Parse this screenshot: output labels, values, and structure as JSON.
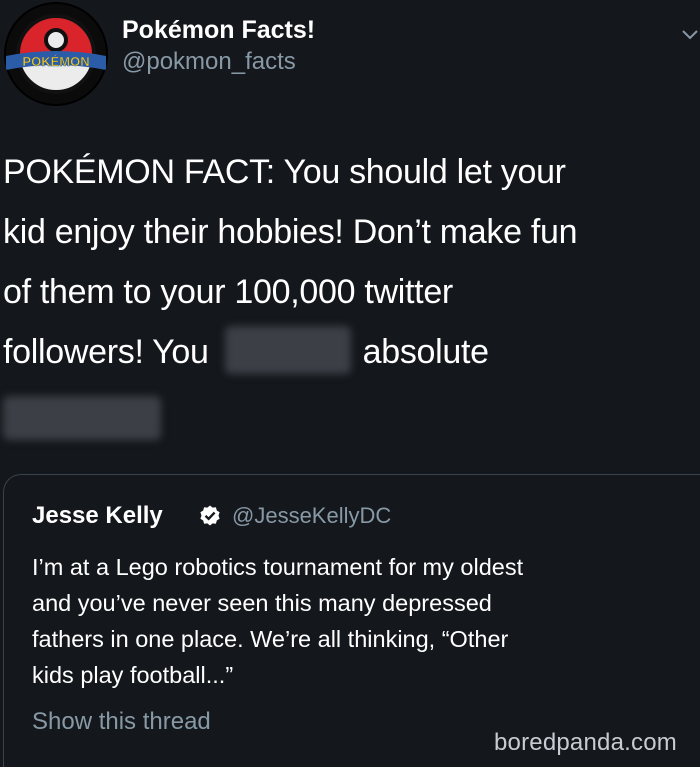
{
  "tweet": {
    "display_name": "Pokémon Facts!",
    "handle": "@pokmon_facts",
    "avatar_logo_text": "POKÉMON",
    "body_lines": [
      "POKÉMON FACT: You should let your",
      "kid enjoy their hobbies! Don’t make fun",
      "of them to your 100,000 twitter"
    ],
    "body_line4_start": "followers! You",
    "body_line4_end": "absolute"
  },
  "quoted_tweet": {
    "display_name": "Jesse Kelly",
    "handle": "@JesseKellyDC",
    "text_lines": [
      "I’m at a Lego robotics tournament for my oldest",
      "and you’ve never seen this many depressed",
      "fathers in one place. We’re all thinking, “Other",
      "kids play football...”"
    ],
    "show_thread": "Show this thread"
  },
  "watermark": "boredpanda.com",
  "icons": {
    "avatar": "pokeball-logo-icon",
    "chevron": "chevron-down-icon",
    "verified": "verified-badge-icon"
  },
  "colors": {
    "background": "#14171c",
    "primary_text": "#ffffff",
    "secondary_text": "#8899a6",
    "border": "#38444d"
  }
}
